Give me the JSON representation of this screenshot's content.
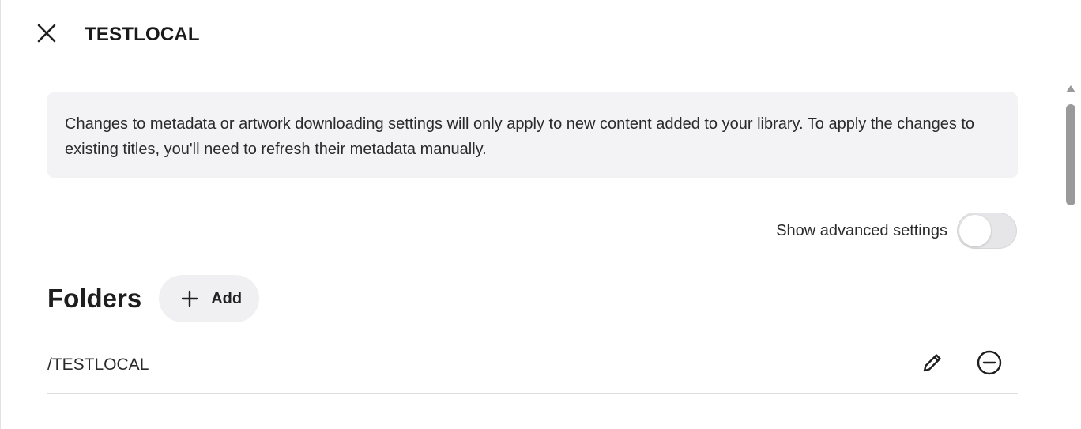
{
  "header": {
    "title": "TESTLOCAL",
    "close_icon": "close-icon"
  },
  "notice": {
    "text": "Changes to metadata or artwork downloading settings will only apply to new content added to your library. To apply the changes to existing titles, you'll need to refresh their metadata manually."
  },
  "advanced": {
    "label": "Show advanced settings",
    "enabled": false
  },
  "folders": {
    "title": "Folders",
    "add_label": "Add",
    "add_icon": "plus-icon",
    "items": [
      {
        "path": "/TESTLOCAL",
        "edit_icon": "pencil-icon",
        "remove_icon": "remove-circle-icon"
      }
    ]
  },
  "colors": {
    "notice_bg": "#f3f3f5",
    "toggle_off": "#e6e6e8",
    "button_bg": "#f0f0f2",
    "text": "#1f1f1f"
  }
}
